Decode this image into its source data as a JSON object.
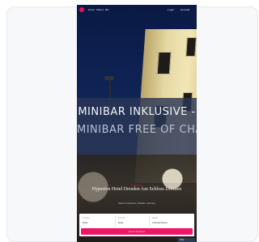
{
  "nav": {
    "links": [
      "Hotel",
      "Offers",
      "DE"
    ],
    "right_links": [
      "Login",
      "Kontakt"
    ]
  },
  "banner": {
    "line1": "MINIBAR INKLUSIVE -",
    "line2": "MINIBAR FREE OF CHARGE"
  },
  "hotel": {
    "stars": "★★★★",
    "name": "Hyperion Hotel Dresden Am Schloss Dresden",
    "subtitle": "Hotel & Conference, Dresden, Germany"
  },
  "booking": {
    "checkin_label": "Anreise",
    "checkin_value": "Date",
    "checkout_label": "Abreise",
    "checkout_value": "Date",
    "guests_label": "Gäste",
    "guests_value": "2 Erwachsene",
    "cta": "Jetzt buchen"
  },
  "chat": {
    "label": "Chat"
  },
  "colors": {
    "accent": "#ec1666",
    "banner": "#2a3656"
  }
}
